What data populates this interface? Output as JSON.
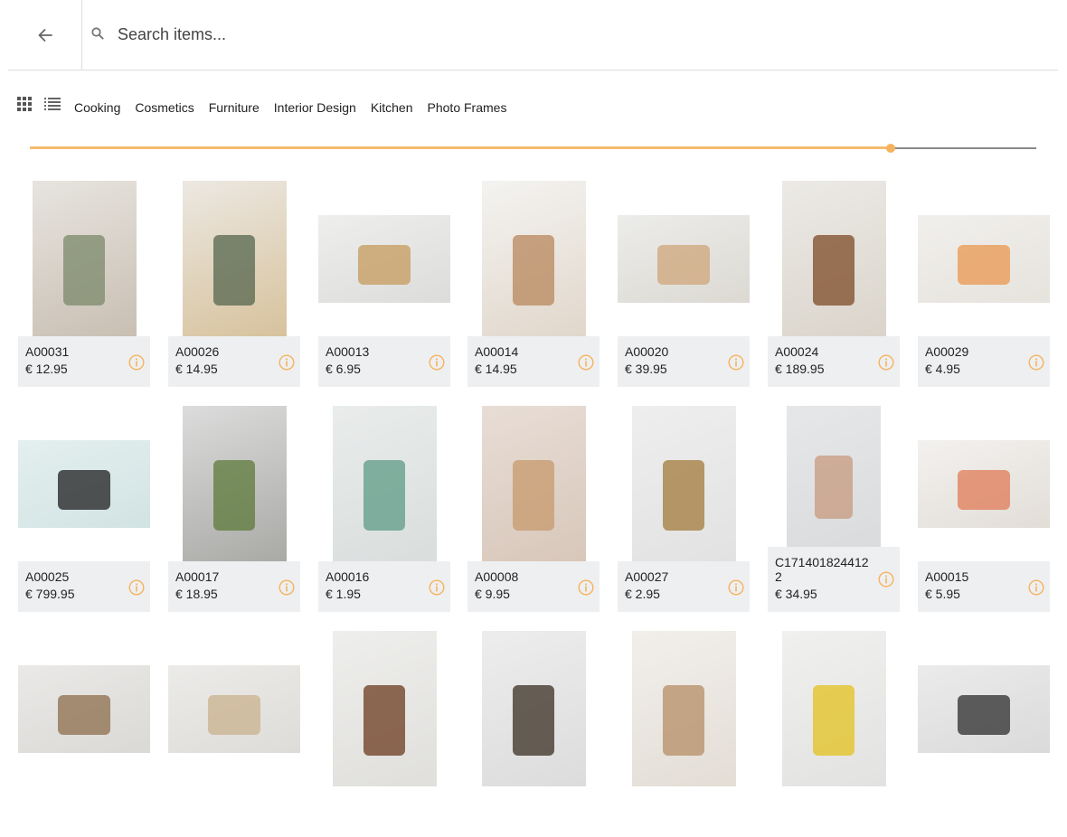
{
  "search": {
    "placeholder": "Search items..."
  },
  "icons": {
    "back": "arrow-left-icon",
    "search": "magnifier-icon",
    "grid": "grid-view-icon",
    "list": "list-view-icon",
    "info": "info-circle-icon"
  },
  "categories": [
    "Cooking",
    "Cosmetics",
    "Furniture",
    "Interior Design",
    "Kitchen",
    "Photo Frames"
  ],
  "slider": {
    "value_fraction": 0.855
  },
  "colors": {
    "accent": "#f6b35d",
    "card_bg": "#eeeff1"
  },
  "products": [
    {
      "code": "A00031",
      "price": "€ 12.95",
      "orient": "portrait",
      "palette": [
        "#e7e4df",
        "#c9bfb3",
        "#7b8a6a"
      ]
    },
    {
      "code": "A00026",
      "price": "€ 14.95",
      "orient": "portrait",
      "palette": [
        "#ece8e2",
        "#d7c29c",
        "#55664e"
      ]
    },
    {
      "code": "A00013",
      "price": "€ 6.95",
      "orient": "landscape",
      "palette": [
        "#eeeeec",
        "#dcdcda",
        "#c59a5c"
      ]
    },
    {
      "code": "A00014",
      "price": "€ 14.95",
      "orient": "portrait",
      "palette": [
        "#f4f3f1",
        "#e1d7cb",
        "#b8875c"
      ]
    },
    {
      "code": "A00020",
      "price": "€ 39.95",
      "orient": "landscape",
      "palette": [
        "#ececea",
        "#dcd9d2",
        "#cfa57a"
      ]
    },
    {
      "code": "A00024",
      "price": "€ 189.95",
      "orient": "portrait",
      "palette": [
        "#eceae6",
        "#dad4cb",
        "#7d4a26"
      ]
    },
    {
      "code": "A00029",
      "price": "€ 4.95",
      "orient": "landscape",
      "palette": [
        "#f1efec",
        "#e6e3dd",
        "#e9974f"
      ]
    },
    {
      "code": "A00025",
      "price": "€ 799.95",
      "orient": "landscape",
      "palette": [
        "#e4efef",
        "#d2e3e3",
        "#1d1d1d"
      ]
    },
    {
      "code": "A00017",
      "price": "€ 18.95",
      "orient": "portrait",
      "palette": [
        "#dcdcdc",
        "#a9a9a6",
        "#5d7a3a"
      ]
    },
    {
      "code": "A00016",
      "price": "€ 1.95",
      "orient": "portrait",
      "palette": [
        "#e9eceb",
        "#d9dedd",
        "#5f9b85"
      ]
    },
    {
      "code": "A00008",
      "price": "€ 9.95",
      "orient": "portrait",
      "palette": [
        "#e8ddd6",
        "#d8c7ba",
        "#c79a6c"
      ]
    },
    {
      "code": "A00027",
      "price": "€ 2.95",
      "orient": "portrait",
      "palette": [
        "#eeeeee",
        "#e2e2e2",
        "#a17a3b"
      ]
    },
    {
      "code": "C1714018244122",
      "price": "€ 34.95",
      "orient": "portrait-short",
      "palette": [
        "#e6e7e9",
        "#d9dbdd",
        "#c79a7e"
      ]
    },
    {
      "code": "A00015",
      "price": "€ 5.95",
      "orient": "landscape",
      "palette": [
        "#f3f1ef",
        "#e2ddd7",
        "#e07b55"
      ]
    },
    {
      "code": "",
      "price": "",
      "orient": "landscape",
      "palette": [
        "#eae9e7",
        "#dbd9d6",
        "#8c6d4b"
      ]
    },
    {
      "code": "",
      "price": "",
      "orient": "landscape",
      "palette": [
        "#ecebe9",
        "#dedcd8",
        "#c9b18d"
      ]
    },
    {
      "code": "",
      "price": "",
      "orient": "portrait",
      "palette": [
        "#eeeeec",
        "#e0dfdc",
        "#6b3a1d"
      ]
    },
    {
      "code": "",
      "price": "",
      "orient": "portrait",
      "palette": [
        "#ededed",
        "#dcdcdc",
        "#3a2e22"
      ]
    },
    {
      "code": "",
      "price": "",
      "orient": "portrait",
      "palette": [
        "#f2efeb",
        "#e3ddd6",
        "#b58d66"
      ]
    },
    {
      "code": "",
      "price": "",
      "orient": "portrait",
      "palette": [
        "#f0f0ee",
        "#e2e2e0",
        "#e3c21f"
      ]
    },
    {
      "code": "",
      "price": "",
      "orient": "landscape",
      "palette": [
        "#ebebeb",
        "#dadada",
        "#2c2c2c"
      ]
    }
  ]
}
